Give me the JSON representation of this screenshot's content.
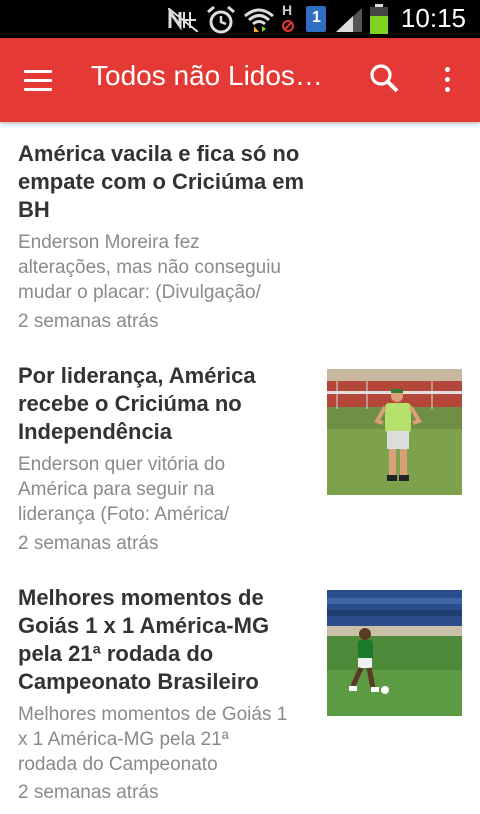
{
  "status_bar": {
    "time": "10:15",
    "icons": [
      "nfc-icon",
      "alarm-icon",
      "wifi-icon",
      "h-data-icon",
      "sim-1-icon",
      "signal-icon",
      "battery-icon"
    ],
    "sim_label": "1",
    "data_label": "H"
  },
  "app_bar": {
    "title": "Todos não Lidos…",
    "icons": [
      "hamburger-menu-icon",
      "search-icon",
      "more-vertical-icon"
    ],
    "color": "#e53935"
  },
  "articles": [
    {
      "title_lines": [
        "América vacila e fica só no",
        "empate com o Criciúma em",
        "BH"
      ],
      "summary_lines": [
        "Enderson Moreira fez",
        "alterações, mas não conseguiu",
        "mudar o placar: (Divulgação/"
      ],
      "time": "2 semanas atrás",
      "has_thumbnail": false
    },
    {
      "title_lines": [
        "Por liderança, América",
        "recebe o Criciúma no",
        "Independência"
      ],
      "summary_lines": [
        "Enderson quer vitória do",
        "América para seguir na",
        "liderança (Foto: América/"
      ],
      "time": "2 semanas atrás",
      "has_thumbnail": true,
      "thumbnail": "coach-on-field-photo"
    },
    {
      "title_lines": [
        "Melhores momentos de",
        "Goiás 1 x 1 América-MG",
        "pela 21ª rodada do",
        "Campeonato Brasileiro"
      ],
      "summary_lines": [
        "Melhores momentos de Goiás 1",
        "x 1 América-MG pela 21ª",
        "rodada do Campeonato"
      ],
      "time": "2 semanas atrás",
      "has_thumbnail": true,
      "thumbnail": "player-in-stadium-photo"
    }
  ]
}
